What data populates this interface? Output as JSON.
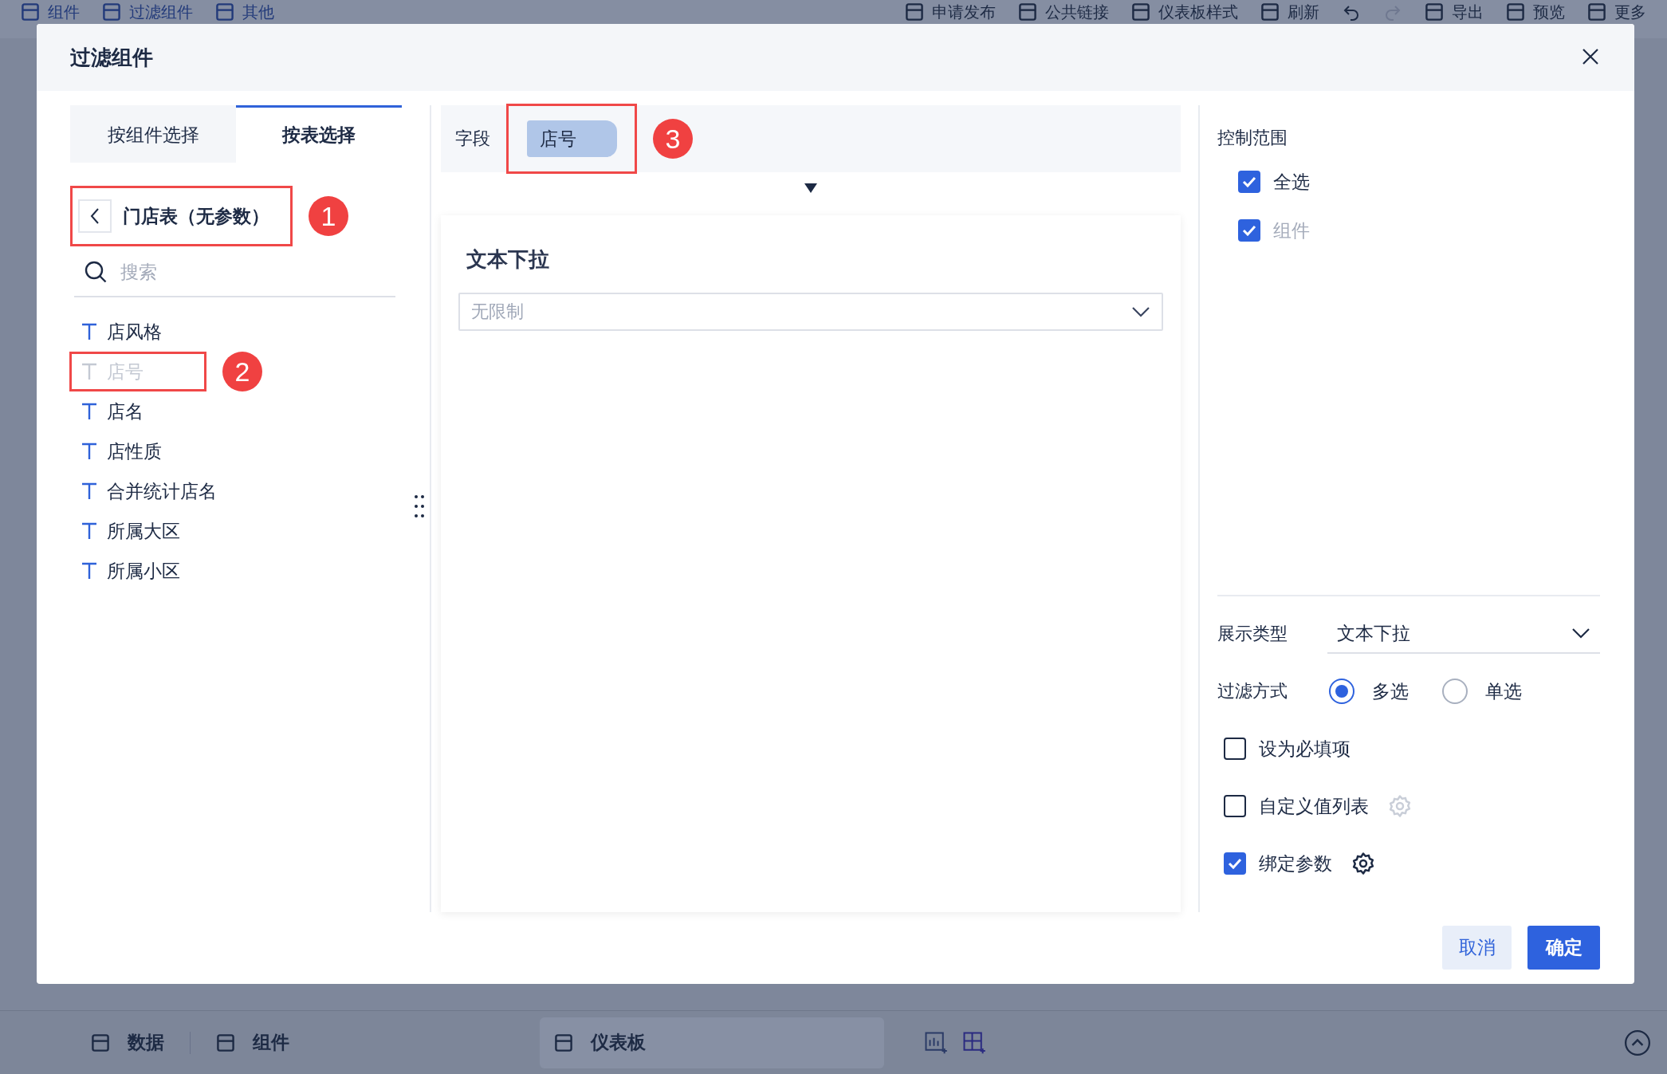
{
  "toolbar": {
    "left": [
      {
        "label": "组件"
      },
      {
        "label": "过滤组件"
      },
      {
        "label": "其他"
      }
    ],
    "right": [
      {
        "kind": "text",
        "label": "申请发布"
      },
      {
        "kind": "text",
        "label": "公共链接"
      },
      {
        "kind": "text",
        "label": "仪表板样式"
      },
      {
        "kind": "text",
        "label": "刷新"
      },
      {
        "kind": "undo"
      },
      {
        "kind": "redo"
      },
      {
        "kind": "text",
        "label": "导出"
      },
      {
        "kind": "text",
        "label": "预览"
      },
      {
        "kind": "text",
        "label": "更多"
      }
    ]
  },
  "dialog": {
    "title": "过滤组件",
    "tabs": [
      {
        "label": "按组件选择",
        "selected": false
      },
      {
        "label": "按表选择",
        "selected": true
      }
    ],
    "table": {
      "title": "门店表（无参数）",
      "annotation": "1"
    },
    "search": {
      "placeholder": "搜索"
    },
    "fields": [
      {
        "label": "店风格",
        "disabled": false
      },
      {
        "label": "店号",
        "disabled": true,
        "annotation": "2"
      },
      {
        "label": "店名",
        "disabled": false
      },
      {
        "label": "店性质",
        "disabled": false
      },
      {
        "label": "合并统计店名",
        "disabled": false
      },
      {
        "label": "所属大区",
        "disabled": false
      },
      {
        "label": "所属小区",
        "disabled": false
      }
    ],
    "field_bar": {
      "label": "字段",
      "chip": "店号",
      "annotation": "3"
    },
    "preview": {
      "title": "文本下拉",
      "dropdown": {
        "placeholder": "无限制"
      }
    },
    "control_scope": {
      "title": "控制范围",
      "options": [
        {
          "label": "全选",
          "checked": true,
          "disabled": false
        },
        {
          "label": "组件",
          "checked": true,
          "disabled": true
        }
      ]
    },
    "display_type": {
      "label": "展示类型",
      "value": "文本下拉"
    },
    "filter_mode": {
      "label": "过滤方式",
      "options": [
        {
          "label": "多选",
          "selected": true
        },
        {
          "label": "单选",
          "selected": false
        }
      ]
    },
    "checks": [
      {
        "label": "设为必填项",
        "checked": false,
        "has_settings": false
      },
      {
        "label": "自定义值列表",
        "checked": false,
        "has_settings": true,
        "settings_disabled": true
      },
      {
        "label": "绑定参数",
        "checked": true,
        "has_settings": true,
        "settings_disabled": false
      }
    ],
    "buttons": [
      {
        "label": "取消",
        "kind": "secondary"
      },
      {
        "label": "确定",
        "kind": "primary"
      }
    ]
  },
  "bottom_bar": {
    "tabs": [
      {
        "label": "数据",
        "selected": false
      },
      {
        "label": "组件",
        "selected": false
      },
      {
        "label": "仪表板",
        "selected": true
      }
    ]
  }
}
